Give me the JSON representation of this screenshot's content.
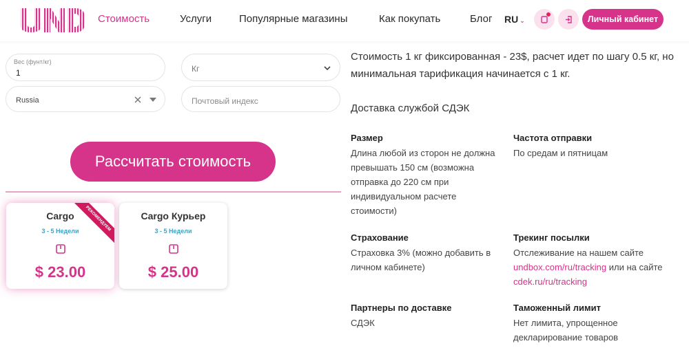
{
  "header": {
    "logo_text": "UND",
    "nav": [
      "Стоимость",
      "Услуги",
      "Популярные магазины",
      "Как покупать",
      "Блог"
    ],
    "lang": "RU",
    "cabinet_label": "Личный кабинет"
  },
  "form": {
    "weight_label": "Вес (фунт/кг)",
    "weight_value": "1",
    "unit_value": "Кг",
    "country_value": "Russia",
    "postal_placeholder": "Почтовый индекс",
    "calc_label": "Рассчитать стоимость"
  },
  "cards": [
    {
      "title": "Cargo",
      "term": "3 - 5 Недели",
      "price": "$ 23.00",
      "ribbon": "РЕКОМЕНДУЕМ"
    },
    {
      "title": "Cargo Курьер",
      "term": "3 - 5 Недели",
      "price": "$ 25.00"
    }
  ],
  "info": {
    "intro": "Стоимость 1 кг фиксированная - 23$, расчет идет по шагу 0.5 кг, но минимальная тарификация начинается с 1 кг.",
    "delivery_heading": "Доставка службой СДЭК",
    "size_title": "Размер",
    "size_text": "Длина любой из сторон не должна превышать 150 см (возможна отправка до 220 см при индивидуальном расчете стоимости)",
    "frequency_title": "Частота отправки",
    "frequency_text": "По средам и пятницам",
    "insurance_title": "Страхование",
    "insurance_text": "Страховка 3% (можно добавить в личном кабинете)",
    "tracking_title": "Трекинг посылки",
    "tracking_text_1": "Отслеживание на нашем сайте",
    "tracking_link_1": "undbox.com/ru/tracking",
    "tracking_text_2": "или на сайте",
    "tracking_link_2": "cdek.ru/ru/tracking",
    "partners_title": "Партнеры по доставке",
    "partners_text": "СДЭК",
    "customs_title": "Таможенный лимит",
    "customs_text": "Нет лимита, упрощенное декларирование товаров"
  },
  "colors": {
    "accent": "#d6338a",
    "term": "#3aa3c6",
    "ribbon": "#d11a5e"
  }
}
